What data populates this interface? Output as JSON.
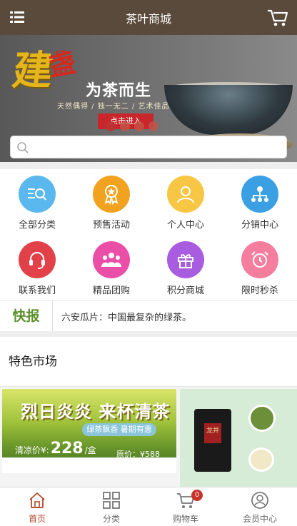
{
  "header": {
    "title": "茶叶商城"
  },
  "banner": {
    "calligraphy_main": "建",
    "calligraphy_accent": "盏",
    "slogan": "为茶而生",
    "subtitle": "天然偶得 / 独一无二 / 艺术佳品",
    "cta": "点击进入",
    "dot_count": 4,
    "active_dot": 0
  },
  "search": {
    "placeholder": "",
    "value": ""
  },
  "grid": [
    {
      "label": "全部分类",
      "icon": "category-search-icon",
      "color": "#5bb8ee"
    },
    {
      "label": "预售活动",
      "icon": "presale-badge-icon",
      "color": "#f1a31f"
    },
    {
      "label": "个人中心",
      "icon": "user-icon",
      "color": "#f7c645"
    },
    {
      "label": "分销中心",
      "icon": "distribution-network-icon",
      "color": "#3b9fe3"
    },
    {
      "label": "联系我们",
      "icon": "headset-icon",
      "color": "#e34149"
    },
    {
      "label": "精品团购",
      "icon": "group-people-icon",
      "color": "#ea4ea7"
    },
    {
      "label": "积分商城",
      "icon": "gift-icon",
      "color": "#a85de0"
    },
    {
      "label": "限时秒杀",
      "icon": "alarm-clock-icon",
      "color": "#f57d9d"
    }
  ],
  "news": {
    "tag": "快报",
    "text": "六安瓜片：中国最复杂的绿茶。"
  },
  "section": {
    "title": "特色市场"
  },
  "market": {
    "card1": {
      "headline": "烈日炎炎  来杯清茶",
      "ribbon": "绿茶飘香 暑期有惠",
      "price_label": "清凉价¥:",
      "price_value": "228",
      "price_unit": "/盒",
      "original": "原价：¥588"
    },
    "card2": {
      "box_label": "龙井"
    }
  },
  "tabbar": [
    {
      "label": "首页",
      "icon": "home-icon",
      "active": true
    },
    {
      "label": "分类",
      "icon": "grid-icon",
      "active": false
    },
    {
      "label": "购物车",
      "icon": "cart-icon",
      "active": false,
      "badge": "0"
    },
    {
      "label": "会员中心",
      "icon": "member-icon",
      "active": false
    }
  ],
  "colors": {
    "header_bg": "#5a4a3b",
    "accent": "#b34a2a",
    "news_tag": "#5b8f2a",
    "badge": "#c8322b"
  }
}
